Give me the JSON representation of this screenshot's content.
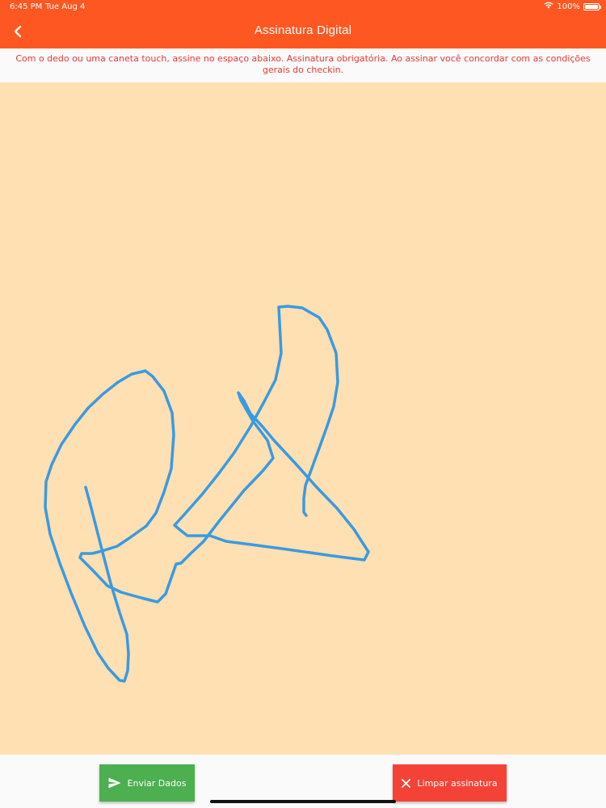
{
  "status_bar": {
    "time": "6:45 PM",
    "date": "Tue Aug 4",
    "battery_text": "100%",
    "battery_level": 1.0,
    "wifi_icon": "wifi-icon",
    "battery_icon": "battery-icon"
  },
  "app_bar": {
    "title": "Assinatura Digital",
    "back_icon": "chevron-left-icon",
    "background_color": "#FF5722"
  },
  "notice": {
    "text": "Com o dedo ou uma caneta touch, assine no espaço abaixo. Assinatura obrigatória. Ao assinar você concordar com as condições gerais do checkin.",
    "color": "#E53935"
  },
  "signature_pad": {
    "background_color": "#FFE0B2",
    "stroke_color": "#3A9AE0",
    "has_signature": true
  },
  "actions": {
    "send": {
      "label": "Enviar Dados",
      "icon": "send-icon",
      "color": "#4CAF50"
    },
    "clear": {
      "label": "Limpar assinatura",
      "icon": "close-icon",
      "color": "#F44336"
    }
  }
}
